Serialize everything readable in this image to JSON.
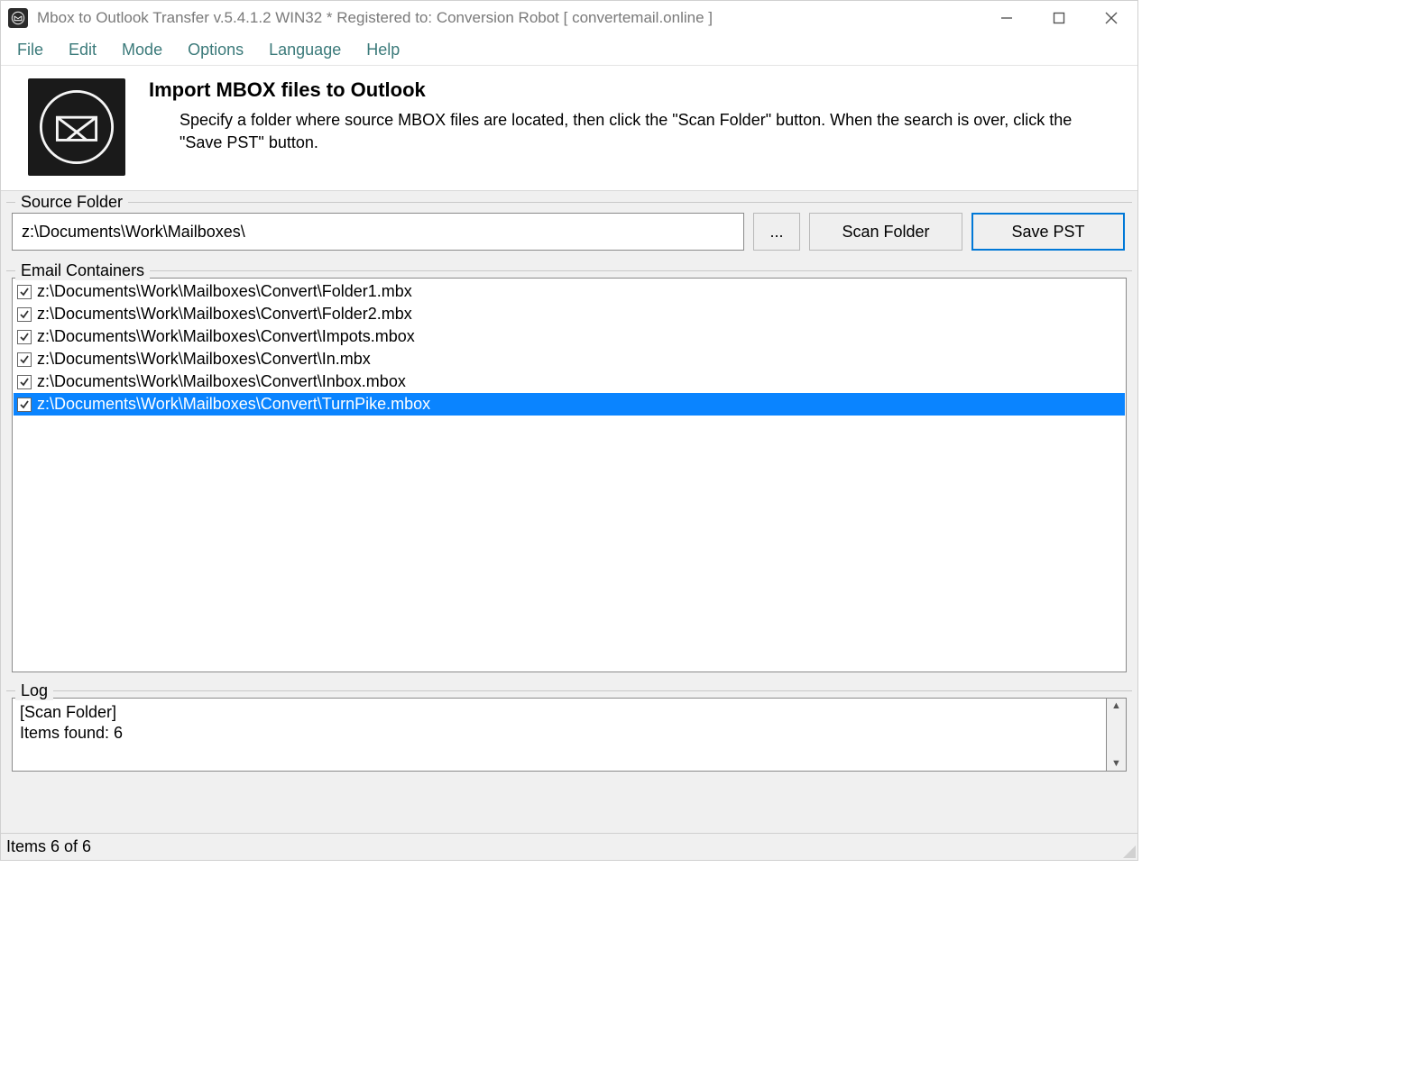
{
  "title": "Mbox to Outlook Transfer v.5.4.1.2 WIN32 * Registered to: Conversion Robot [ convertemail.online ]",
  "menu": {
    "file": "File",
    "edit": "Edit",
    "mode": "Mode",
    "options": "Options",
    "language": "Language",
    "help": "Help"
  },
  "header": {
    "title": "Import MBOX files to Outlook",
    "desc": "Specify a folder where source MBOX files are located, then click the \"Scan Folder\" button. When the search is over, click the \"Save PST\" button."
  },
  "source": {
    "label": "Source Folder",
    "path": "z:\\Documents\\Work\\Mailboxes\\",
    "browse": "...",
    "scan": "Scan Folder",
    "save": "Save PST"
  },
  "containers": {
    "label": "Email Containers",
    "items": [
      {
        "checked": true,
        "selected": false,
        "path": "z:\\Documents\\Work\\Mailboxes\\Convert\\Folder1.mbx"
      },
      {
        "checked": true,
        "selected": false,
        "path": "z:\\Documents\\Work\\Mailboxes\\Convert\\Folder2.mbx"
      },
      {
        "checked": true,
        "selected": false,
        "path": "z:\\Documents\\Work\\Mailboxes\\Convert\\Impots.mbox"
      },
      {
        "checked": true,
        "selected": false,
        "path": "z:\\Documents\\Work\\Mailboxes\\Convert\\In.mbx"
      },
      {
        "checked": true,
        "selected": false,
        "path": "z:\\Documents\\Work\\Mailboxes\\Convert\\Inbox.mbox"
      },
      {
        "checked": true,
        "selected": true,
        "path": "z:\\Documents\\Work\\Mailboxes\\Convert\\TurnPike.mbox"
      }
    ]
  },
  "log": {
    "label": "Log",
    "lines": [
      "[Scan Folder]",
      "Items found: 6"
    ]
  },
  "status": "Items 6 of 6"
}
